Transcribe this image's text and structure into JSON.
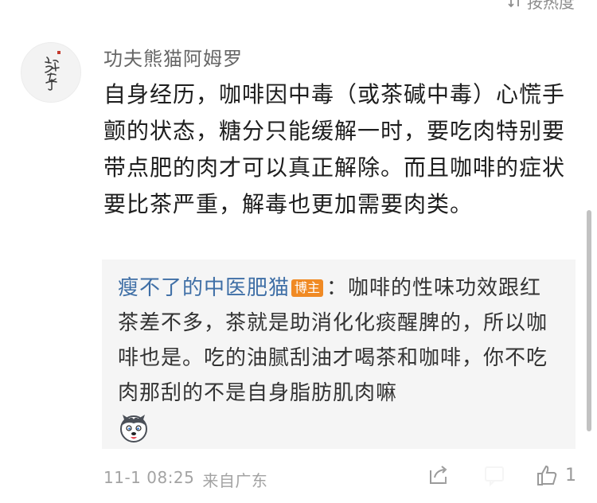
{
  "sort_bar": {
    "label": "按热度",
    "icon": "sort-icon"
  },
  "comment": {
    "avatar_icon": "calligraphy-avatar",
    "username": "功夫熊猫阿姆罗",
    "text": "自身经历，咖啡因中毒（或茶碱中毒）心慌手颤的状态，糖分只能缓解一时，要吃肉特别要带点肥的肉才可以真正解除。而且咖啡的症状要比茶严重，解毒也更加需要肉类。"
  },
  "quote": {
    "username": "瘦不了的中医肥猫",
    "badge": "博主",
    "separator": "：",
    "text": "咖啡的性味功效跟红茶差不多，茶就是助消化化痰醒脾的，所以咖啡也是。吃的油腻刮油才喝茶和咖啡，你不吃肉那刮的不是自身脂肪肌肉嘛",
    "emoji_icon": "husky-emoji"
  },
  "footer": {
    "time": "11-1 08:25",
    "location": "来自广东",
    "like_count": "1",
    "icons": [
      "share-icon",
      "comment-icon",
      "like-icon"
    ]
  },
  "colors": {
    "link_blue": "#3f6fa6",
    "badge_orange": "#f08a24",
    "quote_bg": "#f5f5f5",
    "meta_gray": "#a3a3a3"
  }
}
